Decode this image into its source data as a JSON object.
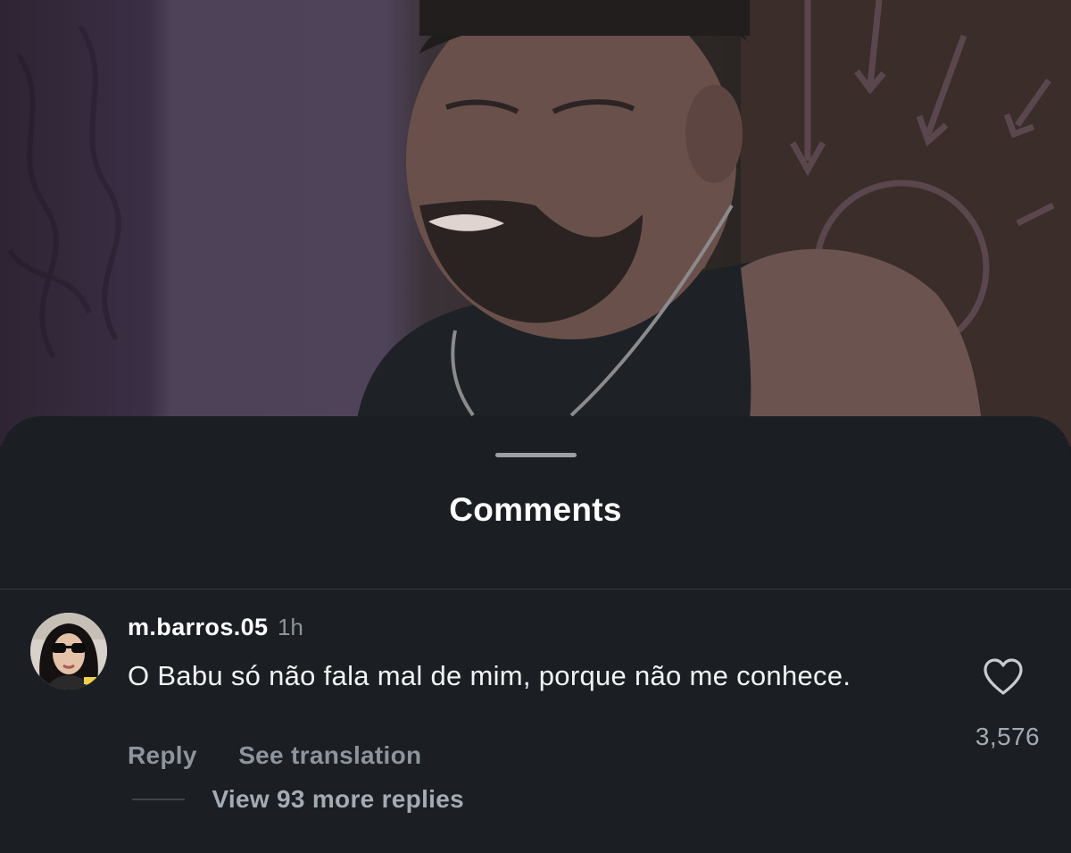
{
  "sheet": {
    "title": "Comments"
  },
  "comment": {
    "username": "m.barros.05",
    "time": "1h",
    "text": "O Babu só não fala mal de mim, porque não me conhece.",
    "reply_label": "Reply",
    "translate_label": "See translation",
    "more_replies_label": "View 93 more replies",
    "like_count": "3,576",
    "like_icon": "heart-outline-icon"
  },
  "colors": {
    "sheet_background": "#1b1f23",
    "primary_text": "#ffffff",
    "secondary_text": "#8e949b"
  }
}
